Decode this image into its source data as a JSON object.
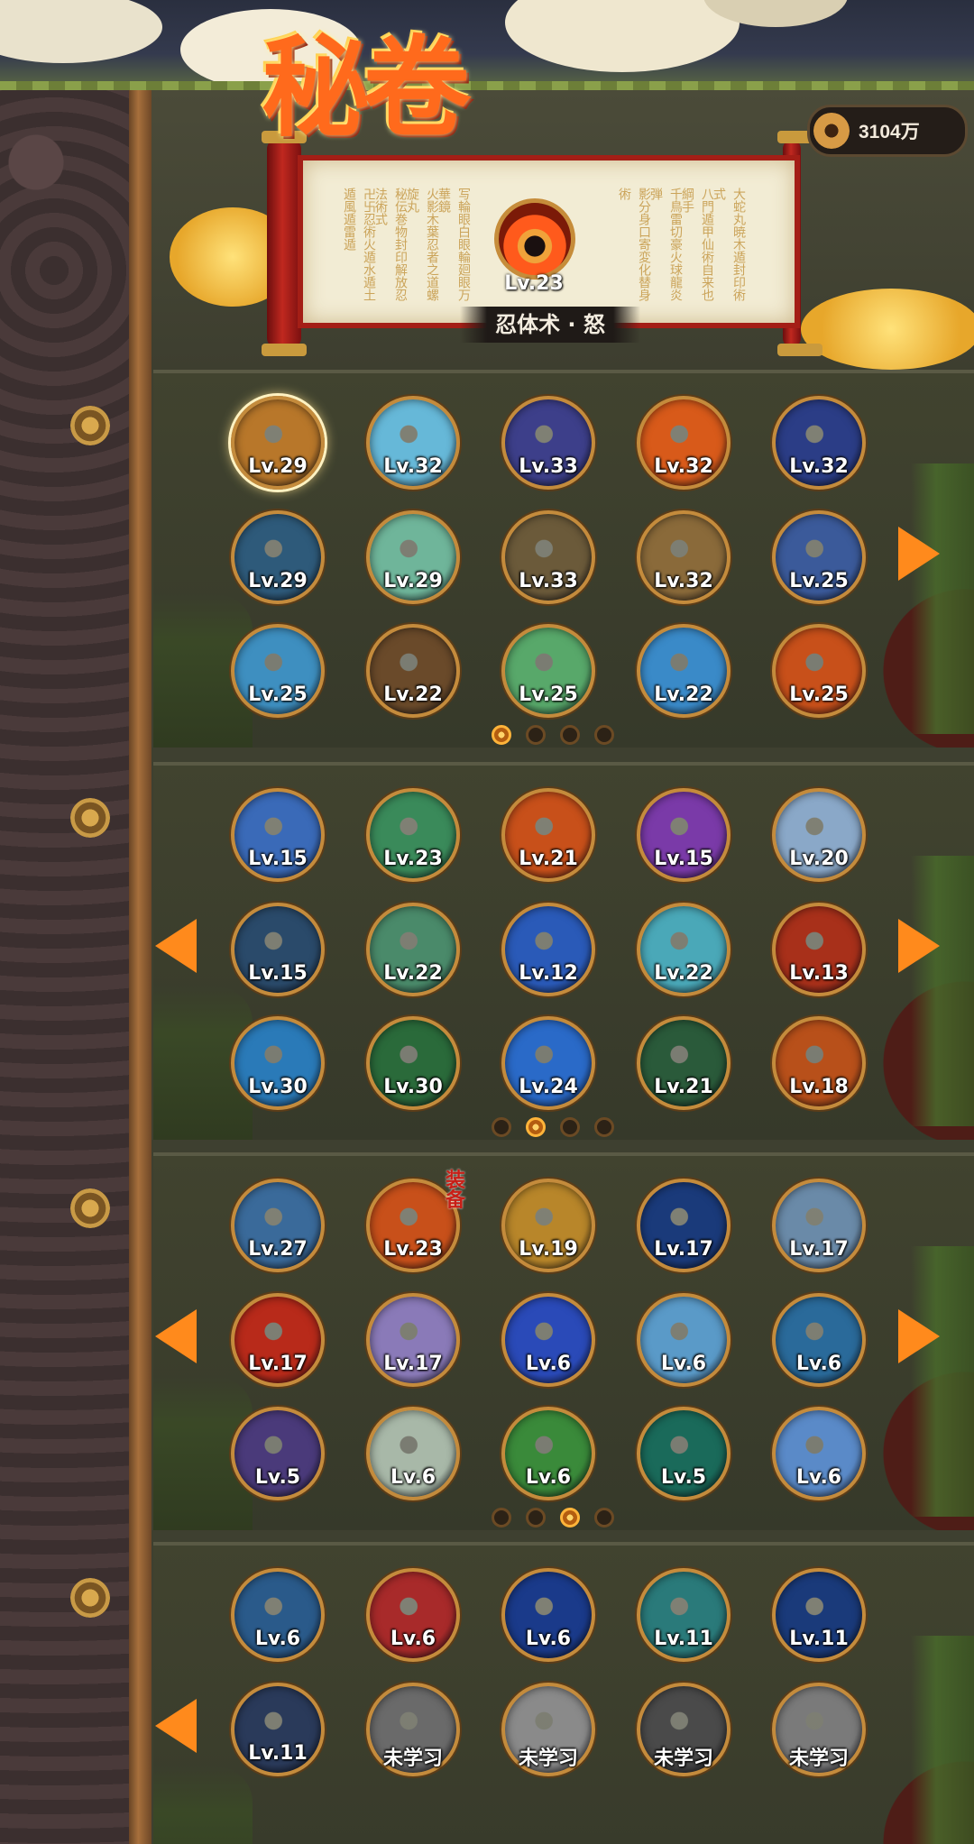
{
  "header": {
    "title": "秘卷",
    "coins": "3104万",
    "featured": {
      "level": "Lv.23",
      "name": "忍体术 · 怒",
      "icon": "flame-ninja-icon"
    }
  },
  "sections": [
    {
      "has_left_arrow": false,
      "has_right_arrow": true,
      "active_page": 0,
      "pages": 4,
      "rows": [
        [
          {
            "level": "Lv.29",
            "icon": "rock-fire-icon",
            "color": "#b8772a",
            "selected": true
          },
          {
            "level": "Lv.32",
            "icon": "water-splash-icon",
            "color": "#66b8d8"
          },
          {
            "level": "Lv.33",
            "icon": "shadow-slash-icon",
            "color": "#3d3f8a"
          },
          {
            "level": "Lv.32",
            "icon": "lava-golem-icon",
            "color": "#d85a1a"
          },
          {
            "level": "Lv.32",
            "icon": "lightning-icon",
            "color": "#2b3d86"
          }
        ],
        [
          {
            "level": "Lv.29",
            "icon": "dark-wing-icon",
            "color": "#2e5a7a"
          },
          {
            "level": "Lv.29",
            "icon": "wind-wrap-icon",
            "color": "#6fb59a"
          },
          {
            "level": "Lv.33",
            "icon": "earth-spikes-icon",
            "color": "#6b5a3a"
          },
          {
            "level": "Lv.32",
            "icon": "boulder-crash-icon",
            "color": "#8a6a3a"
          },
          {
            "level": "Lv.25",
            "icon": "storm-rocks-icon",
            "color": "#3b5a9a"
          }
        ],
        [
          {
            "level": "Lv.25",
            "icon": "ice-shard-icon",
            "color": "#3e8fc0"
          },
          {
            "level": "Lv.22",
            "icon": "log-strike-icon",
            "color": "#6a4a2a"
          },
          {
            "level": "Lv.25",
            "icon": "green-tornado-icon",
            "color": "#58a86a"
          },
          {
            "level": "Lv.22",
            "icon": "ice-ring-icon",
            "color": "#3a8ac8"
          },
          {
            "level": "Lv.25",
            "icon": "fire-pillar-icon",
            "color": "#c8501a"
          }
        ]
      ]
    },
    {
      "has_left_arrow": true,
      "has_right_arrow": true,
      "active_page": 1,
      "pages": 4,
      "rows": [
        [
          {
            "level": "Lv.15",
            "icon": "ice-cloak-icon",
            "color": "#3a6ab8"
          },
          {
            "level": "Lv.23",
            "icon": "green-ninja-icon",
            "color": "#3a8a5a"
          },
          {
            "level": "Lv.21",
            "icon": "flame-burst-icon",
            "color": "#c8501a"
          },
          {
            "level": "Lv.15",
            "icon": "purple-ninja-icon",
            "color": "#7a3aa8"
          },
          {
            "level": "Lv.20",
            "icon": "white-whirl-icon",
            "color": "#8aa8c8"
          }
        ],
        [
          {
            "level": "Lv.15",
            "icon": "dark-sphere-icon",
            "color": "#2a4a6a"
          },
          {
            "level": "Lv.22",
            "icon": "green-cyclone-icon",
            "color": "#4a8a6a"
          },
          {
            "level": "Lv.12",
            "icon": "blue-aura-ninja-icon",
            "color": "#2a5ab8"
          },
          {
            "level": "Lv.22",
            "icon": "ice-crystal-icon",
            "color": "#4aa8b8"
          },
          {
            "level": "Lv.13",
            "icon": "red-ring-ninja-icon",
            "color": "#a8301a"
          }
        ],
        [
          {
            "level": "Lv.30",
            "icon": "blue-shuriken-icon",
            "color": "#2a7ab8"
          },
          {
            "level": "Lv.30",
            "icon": "golden-walls-icon",
            "color": "#2a6a3a"
          },
          {
            "level": "Lv.24",
            "icon": "water-spiral-icon",
            "color": "#2a6ac8"
          },
          {
            "level": "Lv.21",
            "icon": "leaf-blade-icon",
            "color": "#2a5a3a"
          },
          {
            "level": "Lv.18",
            "icon": "chained-ninja-icon",
            "color": "#b8501a"
          }
        ]
      ]
    },
    {
      "has_left_arrow": true,
      "has_right_arrow": true,
      "active_page": 2,
      "pages": 4,
      "rows": [
        [
          {
            "level": "Lv.27",
            "icon": "frost-ninja-icon",
            "color": "#3a6a9a"
          },
          {
            "level": "Lv.23",
            "icon": "flame-ninja-icon",
            "color": "#c8501a",
            "tag": "装备"
          },
          {
            "level": "Lv.19",
            "icon": "golden-sage-icon",
            "color": "#b8862a"
          },
          {
            "level": "Lv.17",
            "icon": "blue-spark-ninja-icon",
            "color": "#1a3a7a"
          },
          {
            "level": "Lv.17",
            "icon": "white-tornado-icon",
            "color": "#6a8aa8"
          }
        ],
        [
          {
            "level": "Lv.17",
            "icon": "red-aura-ninja-icon",
            "color": "#b82a1a"
          },
          {
            "level": "Lv.17",
            "icon": "cloud-ninja-icon",
            "color": "#8a7ab8"
          },
          {
            "level": "Lv.6",
            "icon": "water-dash-icon",
            "color": "#2a4ab8"
          },
          {
            "level": "Lv.6",
            "icon": "ice-cluster-icon",
            "color": "#5a9ac8"
          },
          {
            "level": "Lv.6",
            "icon": "ice-shuriken-icon",
            "color": "#2a6a9a"
          }
        ],
        [
          {
            "level": "Lv.5",
            "icon": "shadow-clones-icon",
            "color": "#4a3a7a"
          },
          {
            "level": "Lv.6",
            "icon": "summon-snake-icon",
            "color": "#a8b8a8"
          },
          {
            "level": "Lv.6",
            "icon": "green-chakra-ninja-icon",
            "color": "#3a8a3a"
          },
          {
            "level": "Lv.5",
            "icon": "teal-vortex-ninja-icon",
            "color": "#1a6a5a"
          },
          {
            "level": "Lv.6",
            "icon": "fire-scroll-icon",
            "color": "#5a8ac8"
          }
        ]
      ]
    },
    {
      "has_left_arrow": true,
      "has_right_arrow": false,
      "active_page": 3,
      "pages": 4,
      "rows": [
        [
          {
            "level": "Lv.6",
            "icon": "water-orb-icon",
            "color": "#2a5a8a"
          },
          {
            "level": "Lv.6",
            "icon": "crimson-pillar-icon",
            "color": "#a82a2a"
          },
          {
            "level": "Lv.6",
            "icon": "blue-lightning-icon",
            "color": "#1a3a8a"
          },
          {
            "level": "Lv.11",
            "icon": "teal-guard-ninja-icon",
            "color": "#2a7a7a"
          },
          {
            "level": "Lv.11",
            "icon": "electric-cage-icon",
            "color": "#1a3a7a"
          }
        ],
        [
          {
            "level": "Lv.11",
            "icon": "orb-ninja-icon",
            "color": "#2a3a5a"
          },
          {
            "level": "未学习",
            "icon": "locked-slash-icon",
            "color": "#6a6a6a"
          },
          {
            "level": "未学习",
            "icon": "locked-burst-icon",
            "color": "#8a8a8a"
          },
          {
            "level": "未学习",
            "icon": "locked-vortex-icon",
            "color": "#4a4a4a"
          },
          {
            "level": "未学习",
            "icon": "locked-stone-icon",
            "color": "#7a7a7a"
          }
        ]
      ]
    }
  ]
}
